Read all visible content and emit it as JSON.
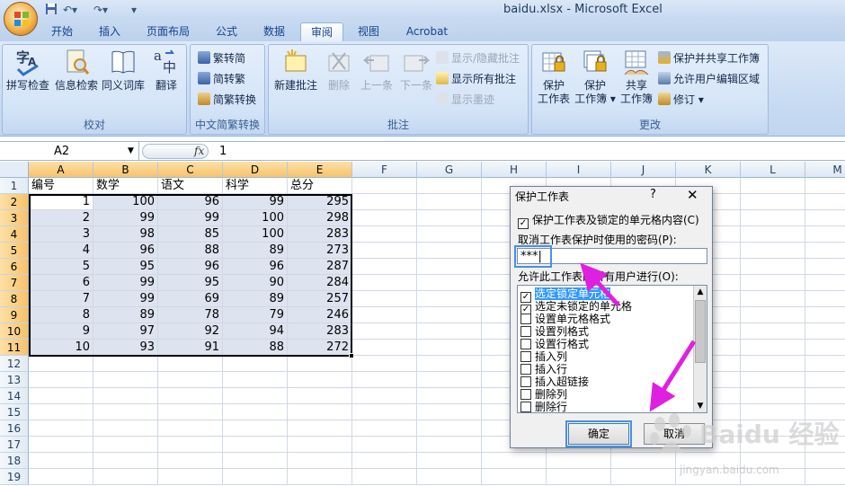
{
  "window": {
    "title": "baidu.xlsx - Microsoft Excel"
  },
  "ribbon": {
    "tabs": [
      "开始",
      "插入",
      "页面布局",
      "公式",
      "数据",
      "审阅",
      "视图",
      "Acrobat"
    ],
    "active_tab": "审阅",
    "groups": {
      "proofing": {
        "label": "校对",
        "spell": "拼写检查",
        "research": "信息检索",
        "thesaurus": "同义词库",
        "translate": "翻译"
      },
      "chinese": {
        "label": "中文简繁转换",
        "to_simple": "繁转简",
        "to_trad": "简转繁",
        "convert": "简繁转换"
      },
      "comments": {
        "label": "批注",
        "new": "新建批注",
        "delete": "删除",
        "prev": "上一条",
        "next": "下一条",
        "show_hide": "显示/隐藏批注",
        "show_all": "显示所有批注",
        "show_ink": "显示墨迹"
      },
      "changes": {
        "label": "更改",
        "protect_sheet": [
          "保护",
          "工作表"
        ],
        "protect_book": [
          "保护",
          "工作簿"
        ],
        "share_book": [
          "共享",
          "工作簿"
        ],
        "protect_share": "保护并共享工作簿",
        "allow_edit": "允许用户编辑区域",
        "track": "修订"
      }
    }
  },
  "formula_bar": {
    "name_box": "A2",
    "fx": "fx",
    "value": "1"
  },
  "sheet": {
    "columns": [
      "A",
      "B",
      "C",
      "D",
      "E",
      "F",
      "G",
      "H",
      "I",
      "J",
      "K",
      "L",
      "M"
    ],
    "headers": [
      "编号",
      "数学",
      "语文",
      "科学",
      "总分"
    ],
    "rows": [
      [
        1,
        100,
        96,
        99,
        295
      ],
      [
        2,
        99,
        99,
        100,
        298
      ],
      [
        3,
        98,
        85,
        100,
        283
      ],
      [
        4,
        96,
        88,
        89,
        273
      ],
      [
        5,
        95,
        96,
        96,
        287
      ],
      [
        6,
        99,
        95,
        90,
        284
      ],
      [
        7,
        99,
        69,
        89,
        257
      ],
      [
        8,
        89,
        78,
        79,
        246
      ],
      [
        9,
        97,
        92,
        94,
        283
      ],
      [
        10,
        93,
        91,
        88,
        272
      ]
    ],
    "row_numbers": [
      1,
      2,
      3,
      4,
      5,
      6,
      7,
      8,
      9,
      10,
      11,
      12,
      13,
      14,
      15,
      16,
      17,
      18,
      19
    ]
  },
  "dialog": {
    "title": "保护工作表",
    "help": "?",
    "close": "✕",
    "protect_label": "保护工作表及锁定的单元格内容(C)",
    "protect_checked": true,
    "password_label": "取消工作表保护时使用的密码(P):",
    "password_value": "***",
    "allow_label": "允许此工作表的所有用户进行(O):",
    "permissions": [
      {
        "label": "选定锁定单元格",
        "checked": true
      },
      {
        "label": "选定未锁定的单元格",
        "checked": true
      },
      {
        "label": "设置单元格格式",
        "checked": false
      },
      {
        "label": "设置列格式",
        "checked": false
      },
      {
        "label": "设置行格式",
        "checked": false
      },
      {
        "label": "插入列",
        "checked": false
      },
      {
        "label": "插入行",
        "checked": false
      },
      {
        "label": "插入超链接",
        "checked": false
      },
      {
        "label": "删除列",
        "checked": false
      },
      {
        "label": "删除行",
        "checked": false
      }
    ],
    "ok": "确定",
    "cancel": "取消"
  },
  "watermark": {
    "text": "Baidu 经验",
    "url": "jingyan.baidu.com"
  },
  "colors": {
    "accent": "#4a90e2",
    "arrow": "#e020e0",
    "selection": "#dde3ef"
  }
}
